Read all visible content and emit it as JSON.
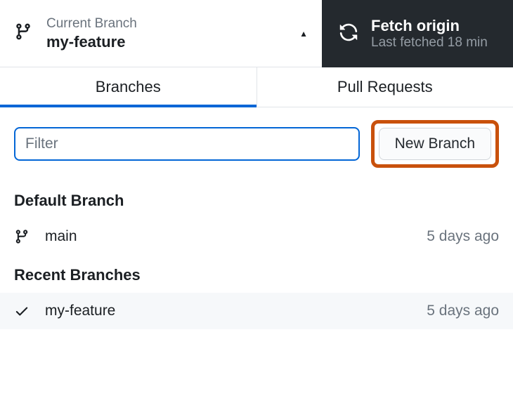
{
  "header": {
    "branchSelector": {
      "label": "Current Branch",
      "name": "my-feature"
    },
    "fetch": {
      "title": "Fetch origin",
      "subtitle": "Last fetched 18 min"
    }
  },
  "tabs": {
    "branches": "Branches",
    "pullRequests": "Pull Requests"
  },
  "filter": {
    "placeholder": "Filter",
    "newBranchLabel": "New Branch"
  },
  "sections": {
    "defaultBranch": {
      "title": "Default Branch",
      "items": [
        {
          "name": "main",
          "time": "5 days ago"
        }
      ]
    },
    "recentBranches": {
      "title": "Recent Branches",
      "items": [
        {
          "name": "my-feature",
          "time": "5 days ago"
        }
      ]
    }
  }
}
